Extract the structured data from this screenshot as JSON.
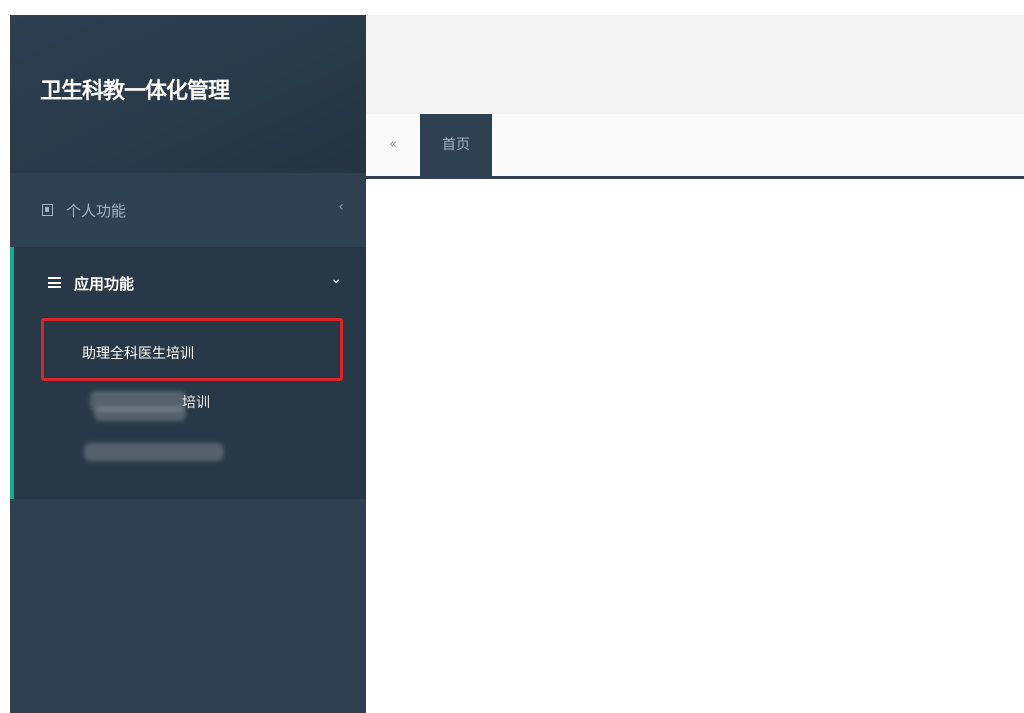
{
  "app": {
    "title": "卫生科教一体化管理"
  },
  "sidebar": {
    "personal": {
      "label": "个人功能",
      "icon": "id-card-icon",
      "chevron": "chevron-left-icon"
    },
    "app_functions": {
      "label": "应用功能",
      "icon": "list-icon",
      "chevron": "chevron-down-icon",
      "items": [
        {
          "label": "助理全科医生培训"
        },
        {
          "label": "培训"
        }
      ]
    }
  },
  "tabs": {
    "back_icon": "double-left-arrow-icon",
    "items": [
      {
        "label": "首页"
      }
    ]
  },
  "colors": {
    "sidebar_bg": "#2f4050",
    "active_bar": "#19aa8d",
    "highlight_border": "#d9262b"
  }
}
